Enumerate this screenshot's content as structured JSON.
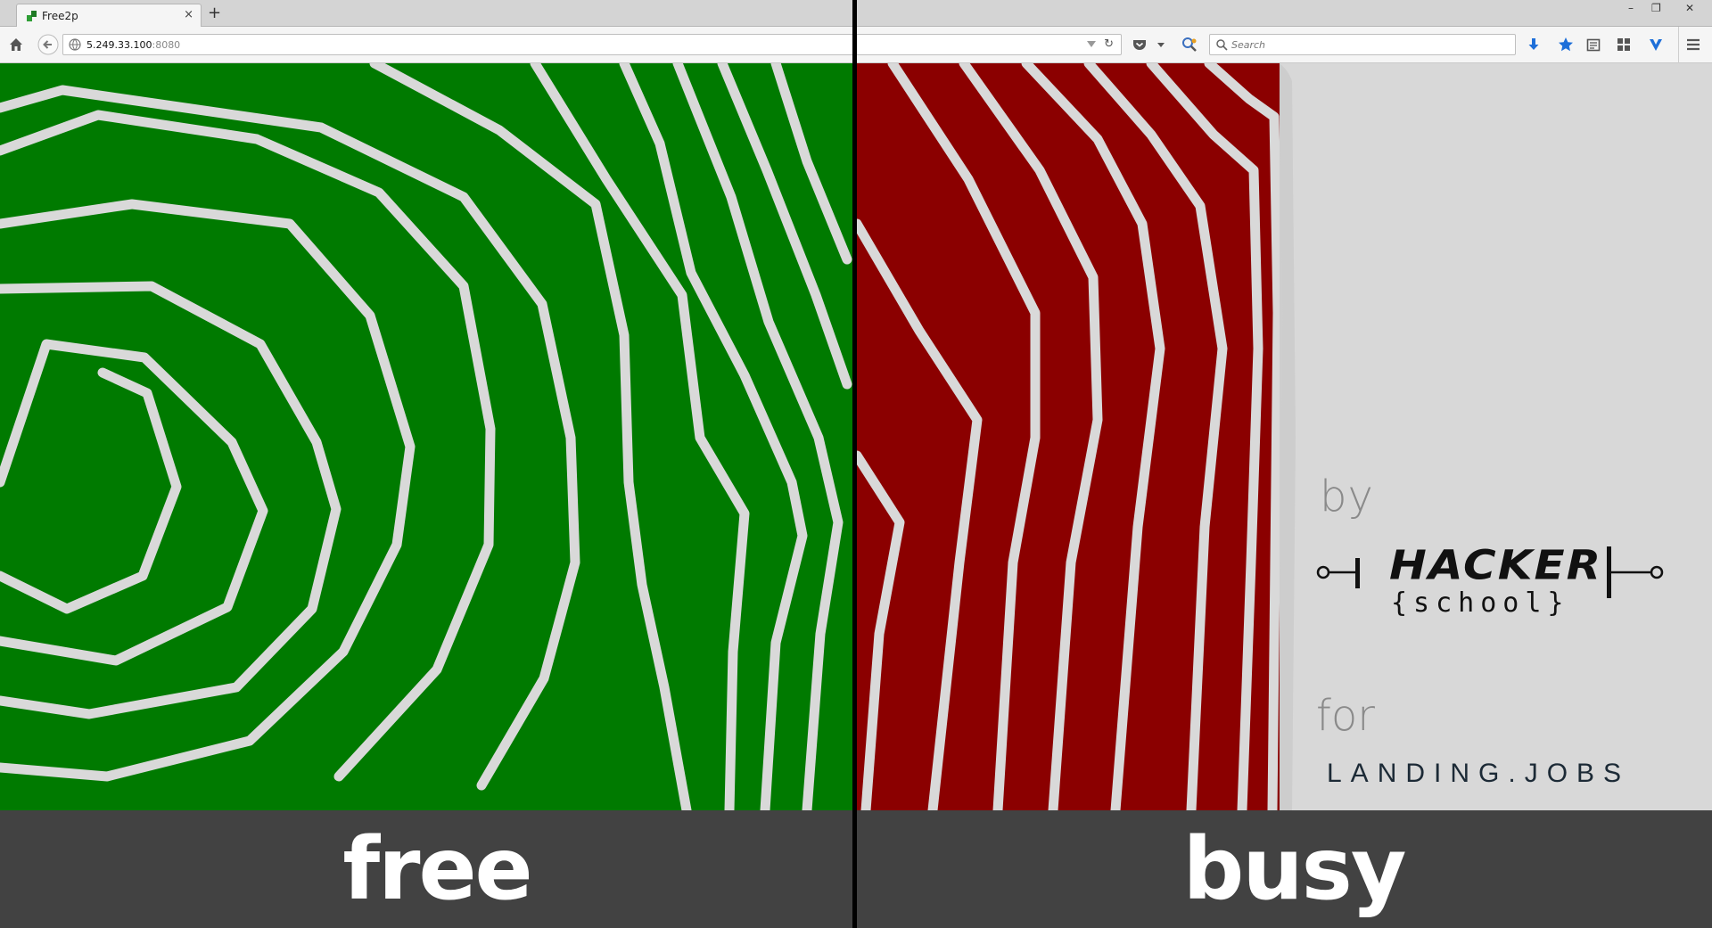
{
  "browser": {
    "tab_title": "Free2p",
    "new_tab_symbol": "+",
    "close_symbol": "×",
    "url_host": "5.249.33.100",
    "url_port": ":8080",
    "search_placeholder": "Search",
    "window_controls": [
      "–",
      "❐",
      "✕"
    ]
  },
  "icons": [
    "home-icon",
    "back-icon",
    "globe-icon",
    "reload-icon",
    "pocket-icon",
    "extension-icon",
    "search-icon",
    "download-icon",
    "bookmark-star-icon",
    "reading-list-icon",
    "grid-icon",
    "vivaldi-icon",
    "menu-icon"
  ],
  "colors": {
    "free": "#007a00",
    "busy": "#8b0000",
    "caption_bar": "#424242",
    "landing_accent": "#5ec1bf"
  },
  "branding": {
    "by": "by",
    "hacker": "HACKER",
    "school": "{school}",
    "for": "for",
    "landing": "LANDING.JOBS"
  },
  "captions": {
    "left": "free",
    "right": "busy"
  }
}
